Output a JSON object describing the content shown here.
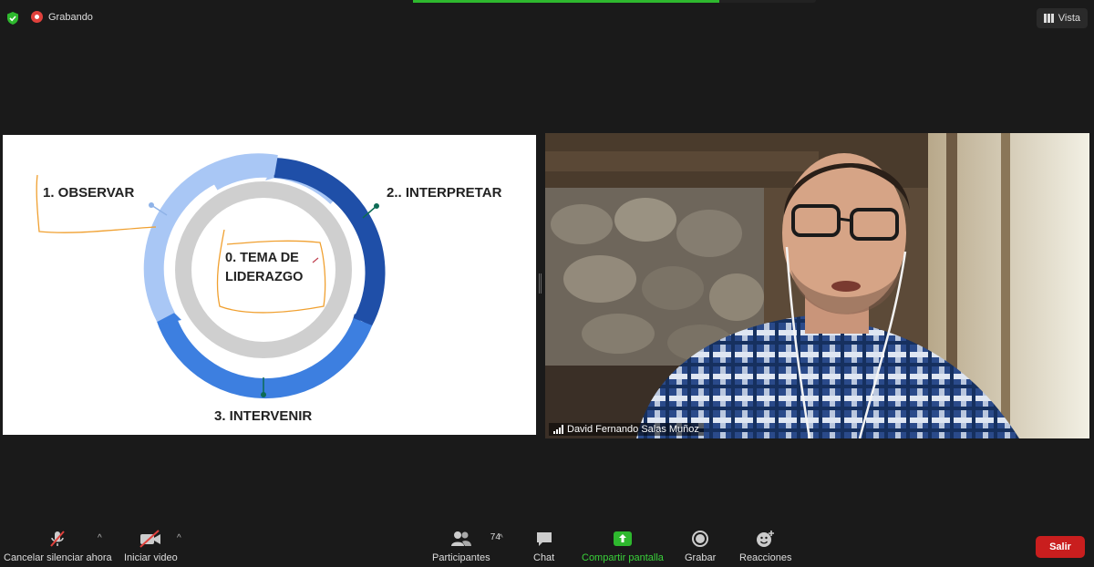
{
  "topbar": {
    "recording_label": "Grabando",
    "view_label": "Vista",
    "share_progress": 0.76
  },
  "slide": {
    "step1": "1.    OBSERVAR",
    "step2": "2.. INTERPRETAR",
    "step3": "3. INTERVENIR",
    "center_line1": "0. TEMA DE",
    "center_line2": "LIDERAZGO"
  },
  "video": {
    "participant_name": "David Fernando Salas Muñoz"
  },
  "toolbar": {
    "mute_label": "Cancelar silenciar ahora",
    "video_label": "Iniciar video",
    "participants_label": "Participantes",
    "participants_count": "74",
    "chat_label": "Chat",
    "share_label": "Compartir pantalla",
    "record_label": "Grabar",
    "reactions_label": "Reacciones",
    "leave_label": "Salir"
  },
  "colors": {
    "share_green": "#2eb82e",
    "leave_red": "#c91e1e",
    "cycle_light_blue": "#a9c7f5",
    "cycle_dark_blue": "#1f4fa8",
    "cycle_mid_blue": "#3d7fe0",
    "annotation_orange": "#f0a030"
  }
}
